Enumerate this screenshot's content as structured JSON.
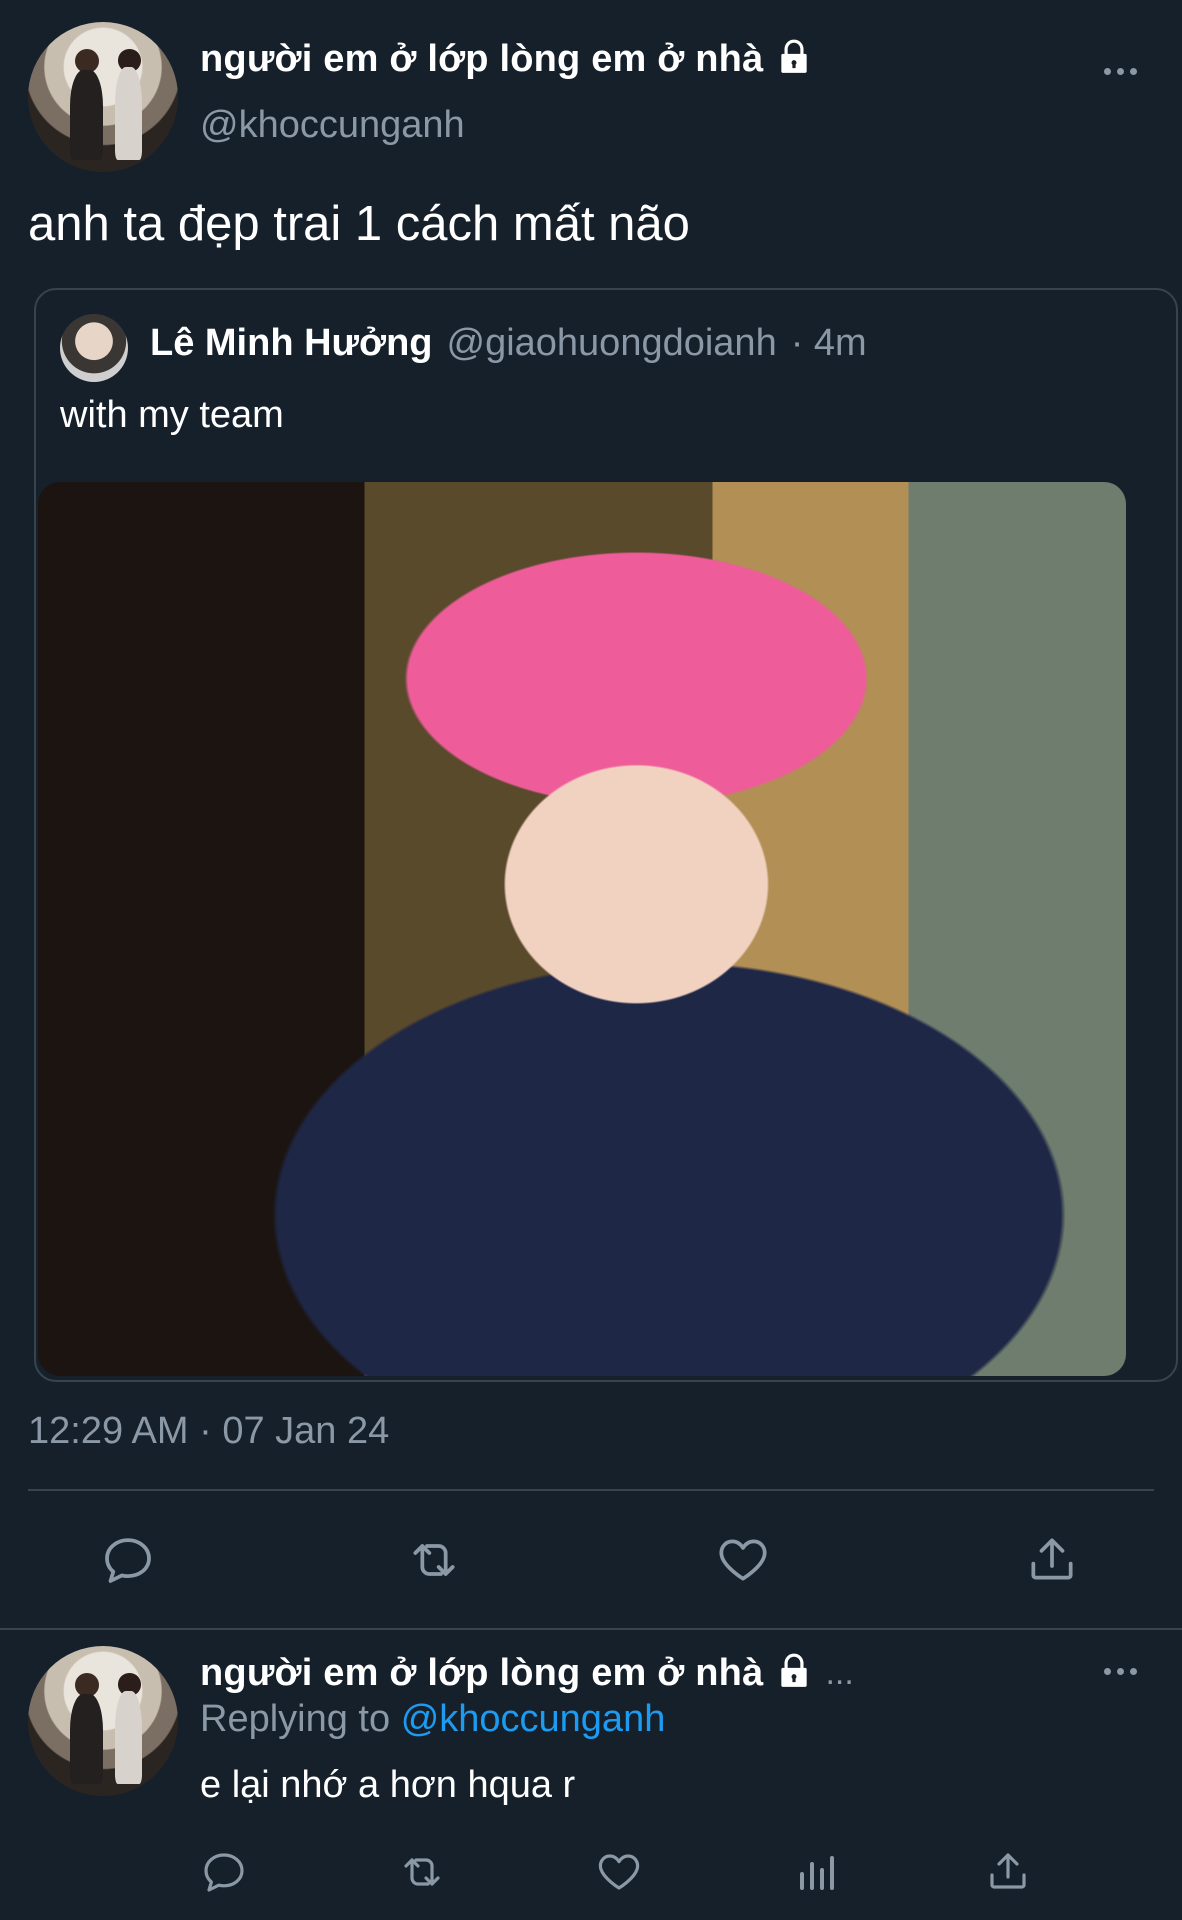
{
  "main_tweet": {
    "display_name": "người em ở lớp lòng em ở nhà",
    "handle": "@khoccunganh",
    "text": "anh ta đẹp trai 1 cách mất não",
    "timestamp": "12:29 AM · 07 Jan 24"
  },
  "quoted_tweet": {
    "display_name": "Lê Minh Hưởng",
    "handle": "@giaohuongdoianh",
    "age": "· 4m",
    "text": "with my team"
  },
  "actions": {
    "icons": [
      "reply-icon",
      "retweet-icon",
      "like-icon",
      "share-icon"
    ]
  },
  "reply": {
    "display_name": "người em ở lớp lòng em ở nhà",
    "ellipsis": "...",
    "replying_to_prefix": "Replying to",
    "replying_to_handle": "@khoccunganh",
    "text": "e lại nhớ a hơn hqua r",
    "icons": [
      "reply-icon",
      "retweet-icon",
      "like-icon",
      "views-icon",
      "share-icon"
    ]
  },
  "colors": {
    "background": "#15202b",
    "muted": "#8b98a5",
    "border": "#38444d",
    "link": "#1d9bf0"
  }
}
